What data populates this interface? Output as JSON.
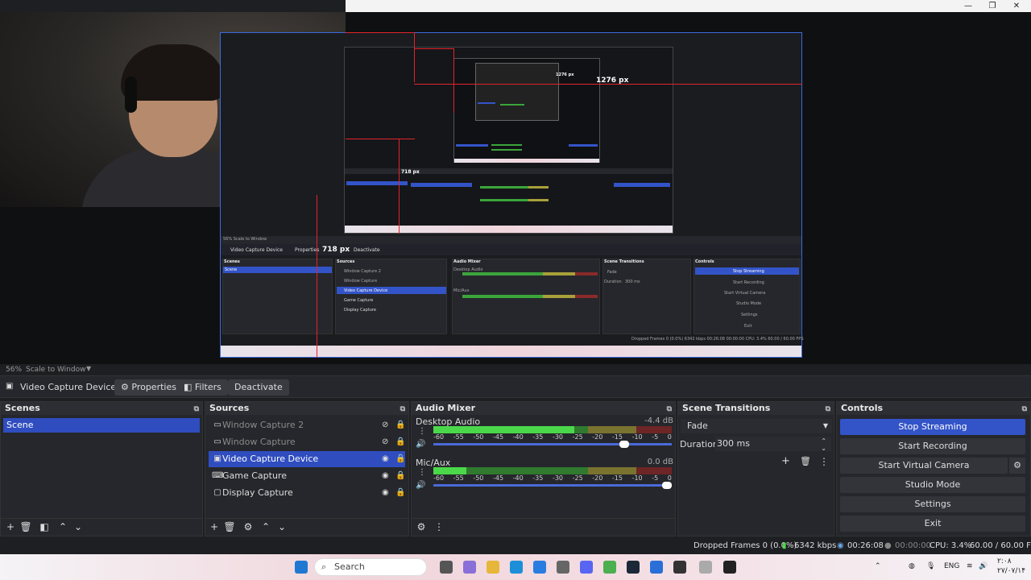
{
  "window": {
    "controls": {
      "minimize": "—",
      "restore": "❐",
      "close": "✕"
    }
  },
  "preview": {
    "measure_width": "1276 px",
    "measure_height": "718 px",
    "inner_measure_width": "1276 px",
    "inner_measure_height": "718 px",
    "zoom_level": "56%",
    "scale_mode": "Scale to Window"
  },
  "nested": {
    "source_name": "Video Capture Device",
    "properties": "Properties",
    "deactivate": "Deactivate",
    "scenes_title": "Scenes",
    "sources_title": "Sources",
    "mixer_title": "Audio Mixer",
    "transitions_title": "Scene Transitions",
    "controls_title": "Controls",
    "scene": "Scene",
    "sources": [
      "Window Capture 2",
      "Window Capture",
      "Video Capture Device",
      "Game Capture",
      "Display Capture"
    ],
    "desktop_audio": "Desktop Audio",
    "mic_aux": "Mic/Aux",
    "fade": "Fade",
    "duration_label": "Duration",
    "duration_value": "300 ms",
    "controls": [
      "Stop Streaming",
      "Start Recording",
      "Start Virtual Camera",
      "Studio Mode",
      "Settings",
      "Exit"
    ],
    "status": "Dropped Frames 0 (0.0%)   6342 kbps   00:26:08   00:00:00   CPU: 3.4%   60.00 / 60.00 FPS"
  },
  "source_toolbar": {
    "source_name": "Video Capture Device",
    "properties": "Properties",
    "filters": "Filters",
    "deactivate": "Deactivate"
  },
  "scenes": {
    "title": "Scenes",
    "items": [
      "Scene"
    ]
  },
  "sources": {
    "title": "Sources",
    "items": [
      {
        "label": "Window Capture 2"
      },
      {
        "label": "Window Capture"
      },
      {
        "label": "Video Capture Device"
      },
      {
        "label": "Game Capture"
      },
      {
        "label": "Display Capture"
      }
    ]
  },
  "mixer": {
    "title": "Audio Mixer",
    "ticks": [
      "-60",
      "-55",
      "-50",
      "-45",
      "-40",
      "-35",
      "-30",
      "-25",
      "-20",
      "-15",
      "-10",
      "-5",
      "0"
    ],
    "channels": [
      {
        "name": "Desktop Audio",
        "db": "-4.4 dB",
        "level": 0.59,
        "volume": 0.8
      },
      {
        "name": "Mic/Aux",
        "db": "0.0 dB",
        "level": 0.14,
        "volume": 0.98
      }
    ]
  },
  "transitions": {
    "title": "Scene Transitions",
    "selected": "Fade",
    "duration_label": "Duration",
    "duration_value": "300 ms"
  },
  "controls": {
    "title": "Controls",
    "buttons": [
      "Stop Streaming",
      "Start Recording",
      "Start Virtual Camera",
      "Studio Mode",
      "Settings",
      "Exit"
    ]
  },
  "status": {
    "dropped_frames": "Dropped Frames 0 (0.0%)",
    "bitrate": "6342 kbps",
    "stream_time": "00:26:08",
    "record_time": "00:00:00",
    "cpu": "CPU: 3.4%",
    "fps": "60.00 / 60.00 FPS"
  },
  "taskbar": {
    "search_placeholder": "Search",
    "lang": "ENG",
    "time": "۲:۰۸",
    "date": "۲۷/۰۷/۱۴"
  },
  "colors": {
    "accent": "#3354c8",
    "bg": "#26272c",
    "red_guide": "#e1242b",
    "meter_green": "#4ad84a"
  }
}
